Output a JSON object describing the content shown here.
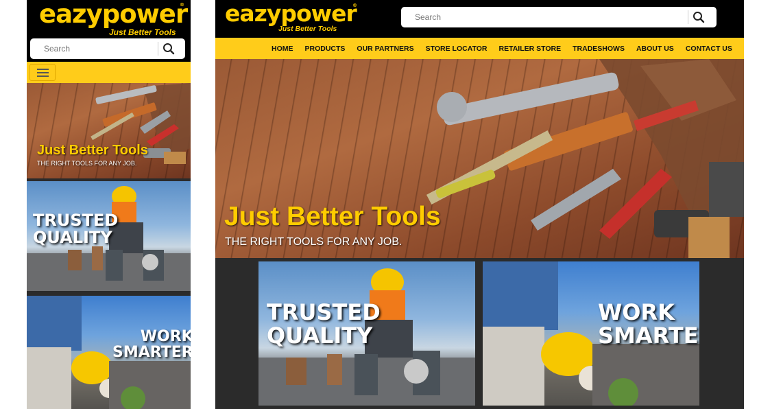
{
  "brand": {
    "logo": "eazypower",
    "trademark": "®",
    "tagline": "Just Better Tools",
    "accent": "#ffcc1a",
    "dark": "#000000"
  },
  "search": {
    "placeholder": "Search",
    "icon": "search-icon"
  },
  "mobile_menu": {
    "icon": "hamburger-icon"
  },
  "nav": {
    "items": [
      "HOME",
      "PRODUCTS",
      "OUR PARTNERS",
      "STORE LOCATOR",
      "RETAILER STORE",
      "TRADESHOWS",
      "ABOUT US",
      "CONTACT US"
    ]
  },
  "hero": {
    "title": "Just Better Tools",
    "subtitle": "THE RIGHT TOOLS FOR ANY JOB.",
    "image": "tool-belt-on-wood"
  },
  "promos": [
    {
      "line1": "TRUSTED",
      "line2": "QUALITY",
      "image": "construction-worker-cutting"
    },
    {
      "line1": "WORK",
      "line2": "SMARTER",
      "image": "worker-holding-hard-hat"
    }
  ]
}
